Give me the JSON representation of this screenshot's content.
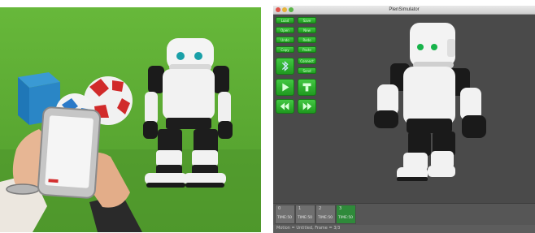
{
  "simulator": {
    "title": "PlenSimulator",
    "buttons": [
      {
        "label": "Load"
      },
      {
        "label": "Save"
      },
      {
        "label": "Open"
      },
      {
        "label": "New"
      },
      {
        "label": "Undo"
      },
      {
        "label": "Redo"
      },
      {
        "label": "Copy"
      },
      {
        "label": "Paste"
      },
      {
        "label": "Bluetooth"
      },
      {
        "label": "Connect"
      },
      {
        "label": "Send"
      }
    ],
    "big_buttons": [
      {
        "icon": "bluetooth-icon"
      },
      {
        "icon": "play-icon"
      },
      {
        "icon": "stop-icon"
      },
      {
        "icon": "prev-frame-icon"
      },
      {
        "icon": "next-frame-icon"
      }
    ],
    "frames": [
      {
        "num": "0",
        "time": "TIME:50",
        "active": false
      },
      {
        "num": "1",
        "time": "TIME:50",
        "active": false
      },
      {
        "num": "2",
        "time": "TIME:50",
        "active": false
      },
      {
        "num": "3",
        "time": "TIME:50",
        "active": true
      }
    ],
    "status": "Motion = Untitled, Frame = 3/3"
  },
  "colors": {
    "green_button": "#2fb52f",
    "viewport_bg": "#4a4a4a",
    "robot_white": "#f2f2f2",
    "robot_black": "#1a1a1a",
    "eye_green": "#17b34a",
    "photo_green": "#5aa832"
  }
}
